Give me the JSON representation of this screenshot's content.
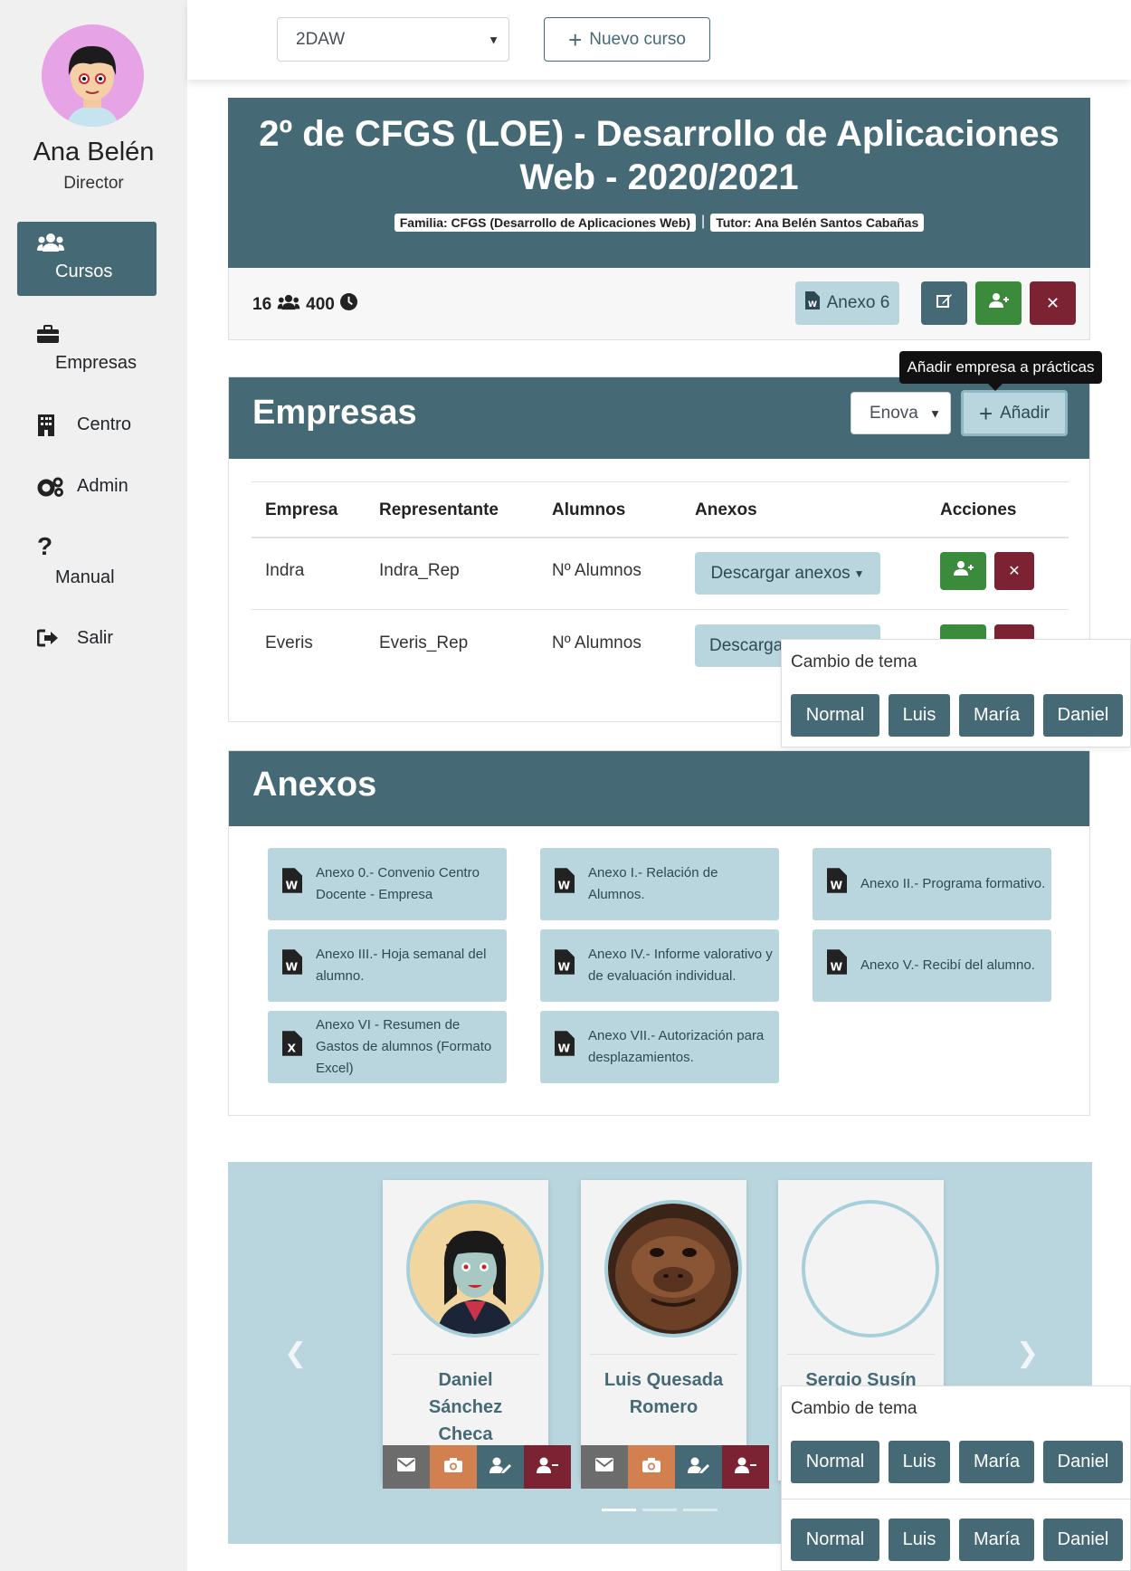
{
  "sidebar": {
    "user_name": "Ana Belén",
    "user_role": "Director",
    "items": [
      {
        "label": "Cursos",
        "icon": "users-icon",
        "active": true
      },
      {
        "label": "Empresas",
        "icon": "briefcase-icon"
      },
      {
        "label": "Centro",
        "icon": "building-icon"
      },
      {
        "label": "Admin",
        "icon": "cogs-icon"
      },
      {
        "label": "Manual",
        "icon": "question-icon"
      },
      {
        "label": "Salir",
        "icon": "sign-out-icon"
      }
    ]
  },
  "topbar": {
    "course_select": "2DAW",
    "new_course_label": "Nuevo curso"
  },
  "course": {
    "title_line1": "2º de CFGS (LOE) - Desarrollo de Aplicaciones",
    "title_line2": "Web - 2020/2021",
    "badge_family": "Familia: CFGS (Desarrollo de Aplicaciones Web)",
    "badge_tutor": "Tutor: Ana Belén Santos Cabañas",
    "students_count": "16",
    "hours": "400",
    "anexo6_label": "Anexo 6"
  },
  "empresas": {
    "title": "Empresas",
    "select_value": "Enova",
    "add_label": "Añadir",
    "tooltip": "Añadir empresa a prácticas",
    "headers": [
      "Empresa",
      "Representante",
      "Alumnos",
      "Anexos",
      "Acciones"
    ],
    "rows": [
      {
        "empresa": "Indra",
        "representante": "Indra_Rep",
        "alumnos": "Nº Alumnos",
        "anexos": "Descargar anexos"
      },
      {
        "empresa": "Everis",
        "representante": "Everis_Rep",
        "alumnos": "Nº Alumnos",
        "anexos": "Descarga"
      }
    ]
  },
  "theme_popup": {
    "title": "Cambio de tema",
    "buttons": [
      "Normal",
      "Luis",
      "María",
      "Daniel"
    ]
  },
  "anexos": {
    "title": "Anexos",
    "items": [
      {
        "label": "Anexo 0.- Convenio Centro Docente - Empresa",
        "type": "word"
      },
      {
        "label": "Anexo I.- Relación de Alumnos.",
        "type": "word"
      },
      {
        "label": "Anexo II.- Programa formativo.",
        "type": "word"
      },
      {
        "label": "Anexo III.- Hoja semanal del alumno.",
        "type": "word"
      },
      {
        "label": "Anexo IV.- Informe valorativo y de evaluación individual.",
        "type": "word"
      },
      {
        "label": "Anexo V.- Recibí del alumno.",
        "type": "word"
      },
      {
        "label": "Anexo VI - Resumen de Gastos de alumnos (Formato Excel)",
        "type": "excel"
      },
      {
        "label": "Anexo VII.- Autorización para desplazamientos.",
        "type": "word"
      }
    ]
  },
  "students": [
    {
      "name": "Daniel Sánchez Checa"
    },
    {
      "name": "Luis Quesada Romero"
    },
    {
      "name": "Sergio Susín"
    }
  ],
  "colors": {
    "primary": "#456a76",
    "light": "#b9d6df",
    "success": "#3c8b3c",
    "danger": "#7b2233",
    "orange": "#d2804f",
    "gray": "#6c6c6c"
  }
}
